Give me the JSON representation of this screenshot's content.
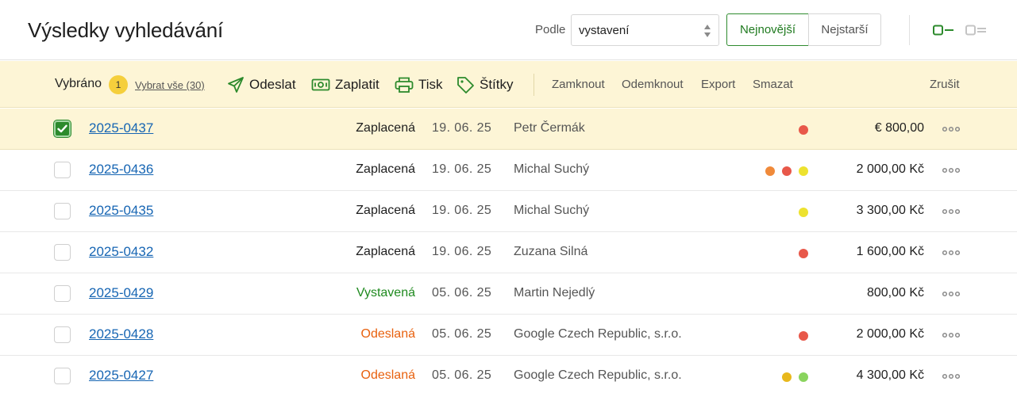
{
  "header": {
    "title": "Výsledky vyhledávání",
    "sort_label": "Podle",
    "sort_value": "vystavení",
    "sort_newest": "Nejnovější",
    "sort_oldest": "Nejstarší"
  },
  "selection": {
    "label": "Vybráno",
    "count": "1",
    "select_all": "Vybrat vše (30)",
    "actions": {
      "send": "Odeslat",
      "pay": "Zaplatit",
      "print": "Tisk",
      "tags": "Štítky",
      "lock": "Zamknout",
      "unlock": "Odemknout",
      "export": "Export",
      "delete": "Smazat",
      "cancel": "Zrušit"
    }
  },
  "colors": {
    "accent_green": "#2c8a2c",
    "link_blue": "#1665b3",
    "status_issued": "#1f8a1f",
    "status_sent": "#e8610e",
    "tag_red": "#e8584a",
    "tag_orange": "#f08a3a",
    "tag_yellow": "#ede22f",
    "tag_amber": "#e8b81c",
    "tag_green": "#8ad45e"
  },
  "invoices": [
    {
      "number": "2025-0437",
      "status": "Zaplacená",
      "status_type": "paid",
      "date": "19. 06. 25",
      "client": "Petr Čermák",
      "tags": [
        "red"
      ],
      "amount": "€ 800,00",
      "selected": true
    },
    {
      "number": "2025-0436",
      "status": "Zaplacená",
      "status_type": "paid",
      "date": "19. 06. 25",
      "client": "Michal Suchý",
      "tags": [
        "orange",
        "red",
        "yellow"
      ],
      "amount": "2 000,00 Kč",
      "selected": false
    },
    {
      "number": "2025-0435",
      "status": "Zaplacená",
      "status_type": "paid",
      "date": "19. 06. 25",
      "client": "Michal Suchý",
      "tags": [
        "yellow"
      ],
      "amount": "3 300,00 Kč",
      "selected": false
    },
    {
      "number": "2025-0432",
      "status": "Zaplacená",
      "status_type": "paid",
      "date": "19. 06. 25",
      "client": "Zuzana Silná",
      "tags": [
        "red"
      ],
      "amount": "1 600,00 Kč",
      "selected": false
    },
    {
      "number": "2025-0429",
      "status": "Vystavená",
      "status_type": "issued",
      "date": "05. 06. 25",
      "client": "Martin Nejedlý",
      "tags": [],
      "amount": "800,00 Kč",
      "selected": false
    },
    {
      "number": "2025-0428",
      "status": "Odeslaná",
      "status_type": "sent",
      "date": "05. 06. 25",
      "client": "Google Czech Republic, s.r.o.",
      "tags": [
        "red"
      ],
      "amount": "2 000,00 Kč",
      "selected": false
    },
    {
      "number": "2025-0427",
      "status": "Odeslaná",
      "status_type": "sent",
      "date": "05. 06. 25",
      "client": "Google Czech Republic, s.r.o.",
      "tags": [
        "amber",
        "green"
      ],
      "amount": "4 300,00 Kč",
      "selected": false
    }
  ]
}
